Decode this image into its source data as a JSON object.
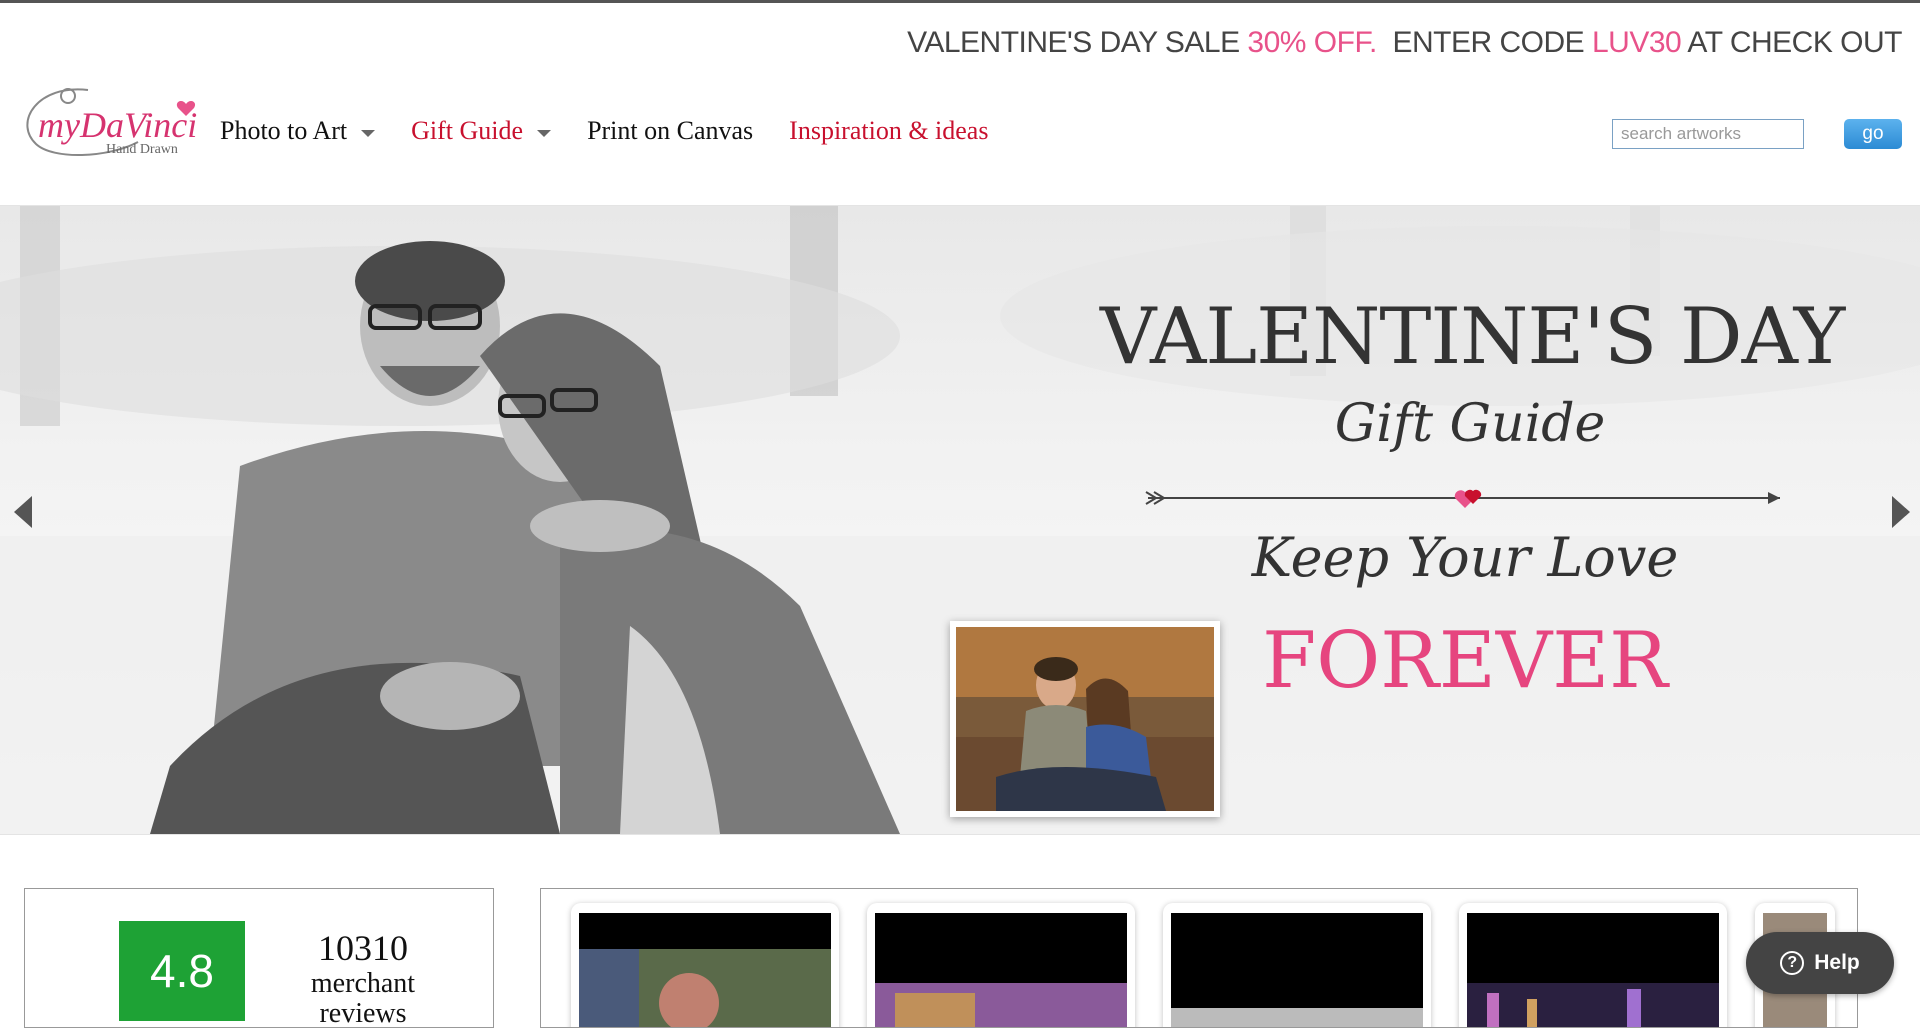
{
  "promo": {
    "part1": "VALENTINE'S DAY SALE ",
    "discount": "30% OFF.",
    "part2": "  ENTER CODE ",
    "code": "LUV30",
    "part3": " AT CHECK OUT"
  },
  "logo": {
    "brand": "myDaVinci",
    "tagline": "Hand Drawn"
  },
  "nav": {
    "items": [
      {
        "label": "Photo to Art",
        "has_dropdown": true,
        "color": "#111111"
      },
      {
        "label": "Gift Guide",
        "has_dropdown": true,
        "color": "#c8102e"
      },
      {
        "label": "Print on Canvas",
        "has_dropdown": false,
        "color": "#111111"
      },
      {
        "label": "Inspiration & ideas",
        "has_dropdown": false,
        "color": "#c8102e"
      }
    ]
  },
  "search": {
    "placeholder": "search artworks",
    "button_label": "go"
  },
  "hero": {
    "title": "VALENTINE'S DAY",
    "subtitle": "Gift Guide",
    "tagline": "Keep Your Love",
    "highlight": "FOREVER",
    "highlight_color": "#e6457f",
    "prev_icon": "chevron-left-icon",
    "next_icon": "chevron-right-icon"
  },
  "reviews": {
    "score": "4.8",
    "count": "10310",
    "label": "merchant reviews",
    "badge_color": "#1ea235"
  },
  "help": {
    "label": "Help",
    "icon": "question-icon"
  }
}
